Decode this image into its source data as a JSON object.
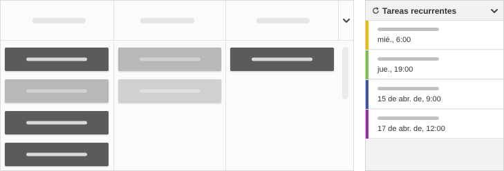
{
  "board": {
    "columns": [
      {
        "cards": [
          "dark",
          "mid",
          "dark",
          "dark"
        ]
      },
      {
        "cards": [
          "mid",
          "light"
        ]
      },
      {
        "cards": [
          "dark"
        ]
      }
    ]
  },
  "recurring_panel": {
    "title": "Tareas recurrentes",
    "header_icon": "refresh-icon",
    "collapse_icon": "chevron-down-icon",
    "tasks": [
      {
        "when": "mié., 6:00",
        "color": "#f5b800"
      },
      {
        "when": "jue., 19:00",
        "color": "#7cc242"
      },
      {
        "when": "15 de abr. de, 9:00",
        "color": "#3b54b5"
      },
      {
        "when": "17 de abr. de, 12:00",
        "color": "#a128b4"
      }
    ]
  }
}
